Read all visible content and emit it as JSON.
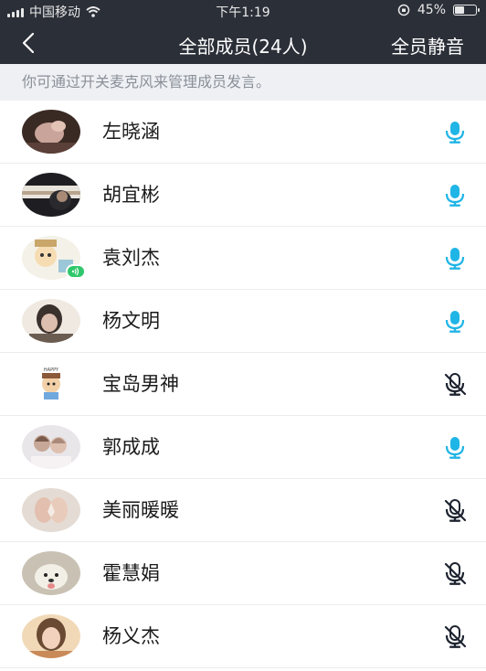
{
  "status_bar": {
    "carrier": "中国移动",
    "time": "下午1:19",
    "battery": "45%",
    "battery_level": 0.45
  },
  "header": {
    "title": "全部成员(24人)",
    "action_label": "全员静音",
    "back_icon": "chevron-left-icon"
  },
  "hint": "你可通过开关麦克风来管理成员发言。",
  "colors": {
    "nav_bg": "#2b2f38",
    "mic_on": "#1fb5e6",
    "mic_off": "#1e2430",
    "speaking": "#2fc76b"
  },
  "members": [
    {
      "name": "左晓涵",
      "mic": "on",
      "avatar": "hands-photo"
    },
    {
      "name": "胡宜彬",
      "mic": "on",
      "avatar": "window-photo"
    },
    {
      "name": "袁刘杰",
      "mic": "on",
      "avatar": "cartoon-photo",
      "speaking": true
    },
    {
      "name": "杨文明",
      "mic": "on",
      "avatar": "portrait-photo"
    },
    {
      "name": "宝岛男神",
      "mic": "off",
      "avatar": "sticker-photo"
    },
    {
      "name": "郭成成",
      "mic": "on",
      "avatar": "couple-photo"
    },
    {
      "name": "美丽暖暖",
      "mic": "off",
      "avatar": "heart-hands-photo"
    },
    {
      "name": "霍慧娟",
      "mic": "off",
      "avatar": "dog-photo"
    },
    {
      "name": "杨义杰",
      "mic": "off",
      "avatar": "girl-photo"
    }
  ]
}
